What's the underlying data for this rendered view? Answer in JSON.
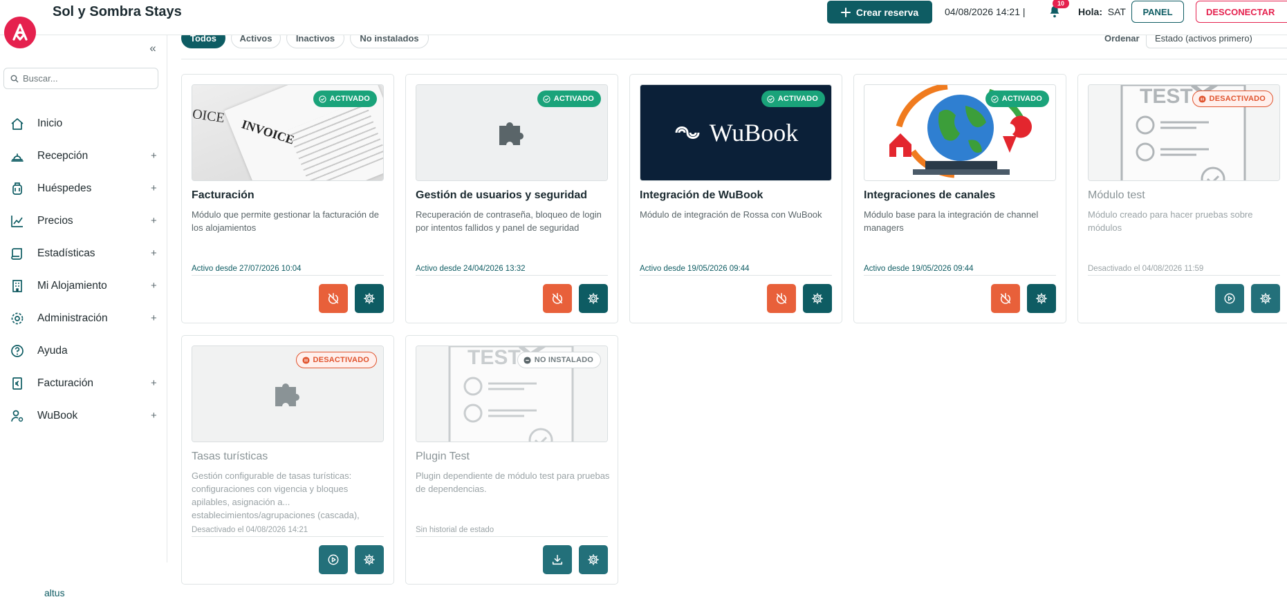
{
  "header": {
    "title": "Sol y Sombra Stays",
    "create_button": "Crear reserva",
    "datetime": "04/08/2026 14:21 |",
    "notifications_count": "10",
    "greeting_label": "Hola:",
    "user": "SAT",
    "panel_button": "PANEL",
    "logout_button": "DESCONECTAR"
  },
  "sidebar": {
    "search_placeholder": "Buscar...",
    "items": [
      {
        "label": "Inicio",
        "icon": "home-icon",
        "expandable": false
      },
      {
        "label": "Recepción",
        "icon": "bell-desk-icon",
        "expandable": true
      },
      {
        "label": "Huéspedes",
        "icon": "luggage-icon",
        "expandable": true
      },
      {
        "label": "Precios",
        "icon": "chart-line-icon",
        "expandable": true
      },
      {
        "label": "Estadísticas",
        "icon": "scroll-icon",
        "expandable": true
      },
      {
        "label": "Mi Alojamiento",
        "icon": "building-icon",
        "expandable": true
      },
      {
        "label": "Administración",
        "icon": "gear-icon",
        "expandable": true
      },
      {
        "label": "Ayuda",
        "icon": "help-circle-icon",
        "expandable": false
      },
      {
        "label": "Facturación",
        "icon": "invoice-icon",
        "expandable": true
      },
      {
        "label": "WuBook",
        "icon": "user-settings-icon",
        "expandable": true
      }
    ],
    "plus": "+"
  },
  "filters": {
    "chips": [
      "Todos",
      "Activos",
      "Inactivos",
      "No instalados"
    ],
    "active_chip": "Todos",
    "sort_label": "Ordenar",
    "sort_value": "Estado (activos primero)"
  },
  "cards": [
    {
      "title": "Facturación",
      "description": "Módulo que permite gestionar la facturación de los alojamientos",
      "status": "Activo desde 27/07/2026 10:04",
      "badge": "ACTIVADO",
      "state": "on"
    },
    {
      "title": "Gestión de usuarios y seguridad",
      "description": "Recuperación de contraseña, bloqueo de login por intentos fallidos y panel de seguridad",
      "status": "Activo desde 24/04/2026 13:32",
      "badge": "ACTIVADO",
      "state": "on"
    },
    {
      "title": "Integración de WuBook",
      "description": "Módulo de integración de Rossa con WuBook",
      "status": "Activo desde 19/05/2026 09:44",
      "badge": "ACTIVADO",
      "state": "on",
      "logo_text": "WuBook"
    },
    {
      "title": "Integraciones de canales",
      "description": "Módulo base para la integración de channel managers",
      "status": "Activo desde 19/05/2026 09:44",
      "badge": "ACTIVADO",
      "state": "on"
    },
    {
      "title": "Módulo test",
      "description": "Módulo creado para hacer pruebas sobre módulos",
      "status": "Desactivado el 04/08/2026 11:59",
      "badge": "DESACTIVADO",
      "state": "off",
      "image_text": "TEST"
    },
    {
      "title": "Tasas turísticas",
      "description": "Gestión configurable de tasas turísticas: configuraciones con vigencia y bloques apilables, asignación a... establecimientos/agrupaciones (cascada),",
      "status": "Desactivado el 04/08/2026 14:21",
      "badge": "DESACTIVADO",
      "state": "off"
    },
    {
      "title": "Plugin Test",
      "description": "Plugin dependiente de módulo test para pruebas de dependencias.",
      "status": "Sin historial de estado",
      "badge": "NO INSTALADO",
      "state": "none",
      "image_text": "TEST"
    }
  ],
  "invoice_image_text": [
    "OICE",
    "INVOICE"
  ],
  "footer": {
    "brand": "altus"
  },
  "colors": {
    "primary": "#0e5c63",
    "accent": "#e5214e",
    "success": "#1aa37a",
    "warning": "#e8603a"
  }
}
